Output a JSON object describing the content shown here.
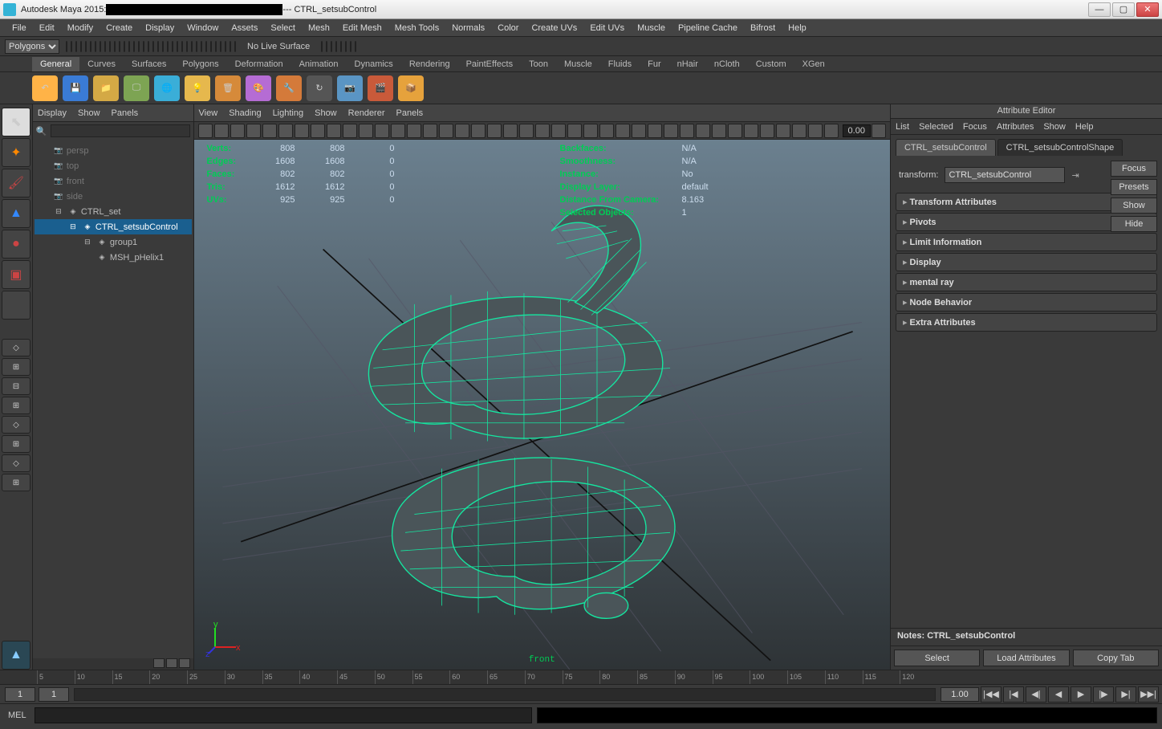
{
  "window": {
    "title_prefix": "Autodesk Maya 2015: ",
    "title_suffix": " --- CTRL_setsubControl",
    "buttons": {
      "min": "—",
      "max": "▢",
      "close": "✕"
    }
  },
  "menubar": [
    "File",
    "Edit",
    "Modify",
    "Create",
    "Display",
    "Window",
    "Assets",
    "Select",
    "Mesh",
    "Edit Mesh",
    "Mesh Tools",
    "Normals",
    "Color",
    "Create UVs",
    "Edit UVs",
    "Muscle",
    "Pipeline Cache",
    "Bifrost",
    "Help"
  ],
  "mode_dropdown": "Polygons",
  "livesurface": "No Live Surface",
  "shelf_tabs": [
    "General",
    "Curves",
    "Surfaces",
    "Polygons",
    "Deformation",
    "Animation",
    "Dynamics",
    "Rendering",
    "PaintEffects",
    "Toon",
    "Muscle",
    "Fluids",
    "Fur",
    "nHair",
    "nCloth",
    "Custom",
    "XGen"
  ],
  "outliner": {
    "menu": [
      "Display",
      "Show",
      "Panels"
    ],
    "items": [
      {
        "label": "persp",
        "indent": 1,
        "dim": true
      },
      {
        "label": "top",
        "indent": 1,
        "dim": true
      },
      {
        "label": "front",
        "indent": 1,
        "dim": true
      },
      {
        "label": "side",
        "indent": 1,
        "dim": true
      },
      {
        "label": "CTRL_set",
        "indent": 1,
        "dim": false,
        "expand": "▣"
      },
      {
        "label": "CTRL_setsubControl",
        "indent": 2,
        "dim": false,
        "sel": true,
        "expand": "▣"
      },
      {
        "label": "group1",
        "indent": 3,
        "dim": false,
        "expand": "▣"
      },
      {
        "label": "MSH_pHelix1",
        "indent": 4,
        "dim": false
      }
    ]
  },
  "viewport": {
    "menu": [
      "View",
      "Shading",
      "Lighting",
      "Show",
      "Renderer",
      "Panels"
    ],
    "field_num": "0.00",
    "camlabel": "front",
    "hud_left": [
      {
        "k": "Verts:",
        "a": "808",
        "b": "808",
        "c": "0"
      },
      {
        "k": "Edges:",
        "a": "1608",
        "b": "1608",
        "c": "0"
      },
      {
        "k": "Faces:",
        "a": "802",
        "b": "802",
        "c": "0"
      },
      {
        "k": "Tris:",
        "a": "1612",
        "b": "1612",
        "c": "0"
      },
      {
        "k": "UVs:",
        "a": "925",
        "b": "925",
        "c": "0"
      }
    ],
    "hud_right": [
      {
        "k": "Backfaces:",
        "v": "N/A"
      },
      {
        "k": "Smoothness:",
        "v": "N/A"
      },
      {
        "k": "Instance:",
        "v": "No"
      },
      {
        "k": "Display Layer:",
        "v": "default"
      },
      {
        "k": "Distance From Camera:",
        "v": "8.163"
      },
      {
        "k": "Selected Objects:",
        "v": "1"
      }
    ]
  },
  "attribute_editor": {
    "title": "Attribute Editor",
    "menu": [
      "List",
      "Selected",
      "Focus",
      "Attributes",
      "Show",
      "Help"
    ],
    "tabs": [
      "CTRL_setsubControl",
      "CTRL_setsubControlShape"
    ],
    "active_tab": 0,
    "transform_label": "transform:",
    "transform_value": "CTRL_setsubControl",
    "side_buttons": [
      "Focus",
      "Presets",
      "Show",
      "Hide"
    ],
    "sections": [
      "Transform Attributes",
      "Pivots",
      "Limit Information",
      "Display",
      "mental ray",
      "Node Behavior",
      "Extra Attributes"
    ],
    "notes_label": "Notes: CTRL_setsubControl",
    "actions": [
      "Select",
      "Load Attributes",
      "Copy Tab"
    ]
  },
  "timeline": {
    "start_outer": "1",
    "start_inner": "1",
    "ticks": [
      "5",
      "10",
      "15",
      "20",
      "25",
      "30",
      "35",
      "40",
      "45",
      "50",
      "55",
      "60",
      "65",
      "70",
      "75",
      "80",
      "85",
      "90",
      "95",
      "100",
      "105",
      "110",
      "115",
      "120"
    ],
    "current": "1.00",
    "playback": [
      "|◀◀",
      "|◀",
      "◀|",
      "◀",
      "▶",
      "|▶",
      "▶|",
      "▶▶|"
    ]
  },
  "command": {
    "lang": "MEL"
  }
}
